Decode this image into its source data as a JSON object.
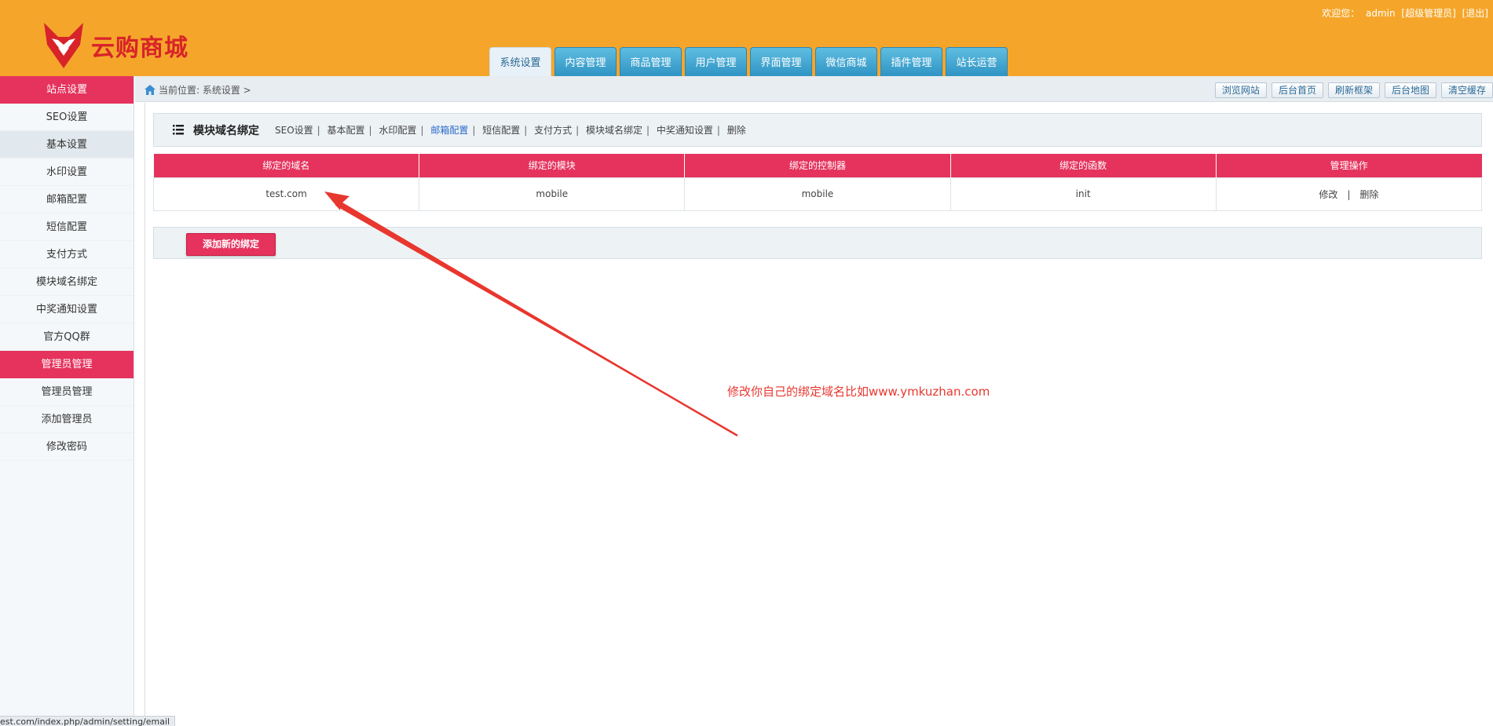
{
  "header": {
    "logo_text": "云购商城",
    "welcome": "欢迎您：",
    "user": "admin",
    "role": "[超级管理员]",
    "logout": "[退出]",
    "tabs": [
      {
        "label": "系统设置",
        "active": true
      },
      {
        "label": "内容管理"
      },
      {
        "label": "商品管理"
      },
      {
        "label": "用户管理"
      },
      {
        "label": "界面管理"
      },
      {
        "label": "微信商城"
      },
      {
        "label": "插件管理"
      },
      {
        "label": "站长运营"
      }
    ]
  },
  "sidebar": {
    "group1": "站点设置",
    "items1": [
      "SEO设置",
      "基本设置",
      "水印设置",
      "邮箱配置",
      "短信配置",
      "支付方式",
      "模块域名绑定",
      "中奖通知设置",
      "官方QQ群"
    ],
    "group2": "管理员管理",
    "items2": [
      "管理员管理",
      "添加管理员",
      "修改密码"
    ]
  },
  "topbar": {
    "breadcrumb": "当前位置: 系统设置 >",
    "buttons": [
      "浏览网站",
      "后台首页",
      "刷新框架",
      "后台地图",
      "清空缓存"
    ]
  },
  "content": {
    "title": "模块域名绑定",
    "links": [
      "SEO设置",
      "基本配置",
      "水印配置",
      "邮箱配置",
      "短信配置",
      "支付方式",
      "模块域名绑定",
      "中奖通知设置",
      "删除"
    ],
    "table": {
      "headers": [
        "绑定的域名",
        "绑定的模块",
        "绑定的控制器",
        "绑定的函数",
        "管理操作"
      ],
      "rows": [
        {
          "domain": "test.com",
          "module": "mobile",
          "controller": "mobile",
          "function": "init",
          "edit": "修改",
          "sep": "|",
          "delete": "删除"
        }
      ]
    },
    "add_button": "添加新的绑定",
    "annotation": "修改你自己的绑定域名比如www.ymkuzhan.com"
  },
  "status_url": "est.com/index.php/admin/setting/email",
  "colors": {
    "header_bg": "#f5a62a",
    "accent": "#e5335d",
    "tab_blue": "#2f94c4",
    "annotation": "#e8372f"
  }
}
